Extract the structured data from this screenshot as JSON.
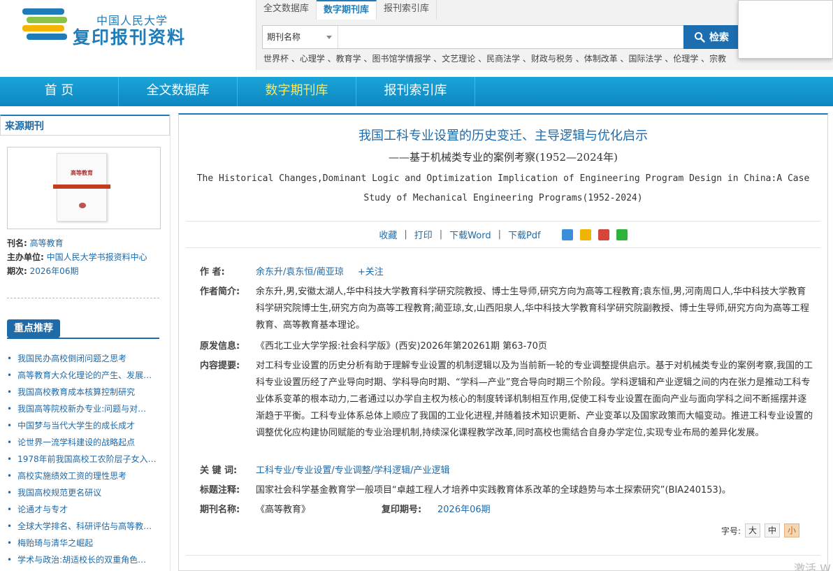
{
  "header": {
    "logo_line1": "中国人民大学",
    "logo_line2": "复印报刊资料",
    "tabs": [
      "全文数据库",
      "数字期刊库",
      "报刊索引库"
    ],
    "select_value": "期刊名称",
    "search_value": "",
    "search_button": "检索",
    "hot_words": "世界杯 、心理学 、教育学 、图书馆学情报学 、文艺理论 、民商法学 、财政与税务 、体制改革 、国际法学 、伦理学 、宗教"
  },
  "nav": [
    "首 页",
    "全文数据库",
    "数字期刊库",
    "报刊索引库"
  ],
  "sidebar": {
    "title": "来源期刊",
    "cover_text": "高等教育",
    "journal_label": "刊名:",
    "journal_value": "高等教育",
    "host_label": "主办单位:",
    "host_value": "中国人民大学书报资料中心",
    "issue_label": "期次:",
    "issue_value": "2026年06期",
    "recommend_title": "重点推荐",
    "recommend": [
      "我国民办高校倒闭问题之思考",
      "高等教育大众化理论的产生、发展…",
      "我国高校教育成本核算控制研究",
      "我国高等院校新办专业:问题与对…",
      "中国梦与当代大学生的成长成才",
      "论世界一流学科建设的战略起点",
      "1978年前我国高校工农阶层子女入…",
      "高校实施绩效工资的理性思考",
      "我国高校规范更名研议",
      "论通才与专才",
      "全球大学排名、科研评估与高等教…",
      "梅贻琦与清华之崛起",
      "学术与政治:胡适校长的双重角色…"
    ]
  },
  "article": {
    "title": "我国工科专业设置的历史变迁、主导逻辑与优化启示",
    "subtitle": "——基于机械类专业的案例考察(1952—2024年)",
    "en_title": "The Historical Changes,Dominant Logic and Optimization Implication of Engineering Program Design in China:A Case Study of Mechanical Engineering Programs(1952-2024)",
    "actions": {
      "favorite": "收藏",
      "print": "打印",
      "download_word": "下载Word",
      "download_pdf": "下载Pdf"
    },
    "author_label": "作  者:",
    "authors": "余东升/袁东恒/蔺亚琼",
    "follow": "+关注",
    "bio_label": "作者简介:",
    "bio": "余东升,男,安徽太湖人,华中科技大学教育科学研究院教授、博士生导师,研究方向为高等工程教育;袁东恒,男,河南周口人,华中科技大学教育科学研究院博士生,研究方向为高等工程教育;蔺亚琼,女,山西阳泉人,华中科技大学教育科学研究院副教授、博士生导师,研究方向为高等工程教育、高等教育基本理论。",
    "source_label": "原发信息:",
    "source": "《西北工业大学学报:社会科学版》(西安)2026年第20261期 第63-70页",
    "abstract_label": "内容提要:",
    "abstract": "对工科专业设置的历史分析有助于理解专业设置的机制逻辑以及为当前新一轮的专业调整提供启示。基于对机械类专业的案例考察,我国的工科专业设置历经了产业导向时期、学科导向时期、“学科—产业”竞合导向时期三个阶段。学科逻辑和产业逻辑之间的内在张力是推动工科专业体系变革的根本动力,二者通过以办学自主权为核心的制度转译机制相互作用,促使工科专业设置在面向产业与面向学科之间不断摇摆并逐渐趋于平衡。工科专业体系总体上顺应了我国的工业化进程,并随着技术知识更新、产业变革以及国家政策而大幅变动。推进工科专业设置的调整优化应构建协同赋能的专业治理机制,持续深化课程教学改革,同时高校也需结合自身办学定位,实现专业布局的差异化发展。",
    "keywords_label": "关 键 词:",
    "keywords": "工科专业/专业设置/专业调整/学科逻辑/产业逻辑",
    "note_label": "标题注释:",
    "note": "国家社会科学基金教育学一般项目“卓越工程人才培养中实践教育体系改革的全球趋势与本土探索研究”(BIA240153)。",
    "journal_label": "期刊名称:",
    "journal": "《高等教育》",
    "reprint_label": "复印期号:",
    "reprint": "2026年06期",
    "font_label": "字号:",
    "font_sizes": [
      "大",
      "中",
      "小"
    ]
  },
  "watermark": "激活 W",
  "colors": {
    "accent": "#1f6aa8",
    "nav": "#0e86c0",
    "nav_active": "#ffe55a"
  }
}
